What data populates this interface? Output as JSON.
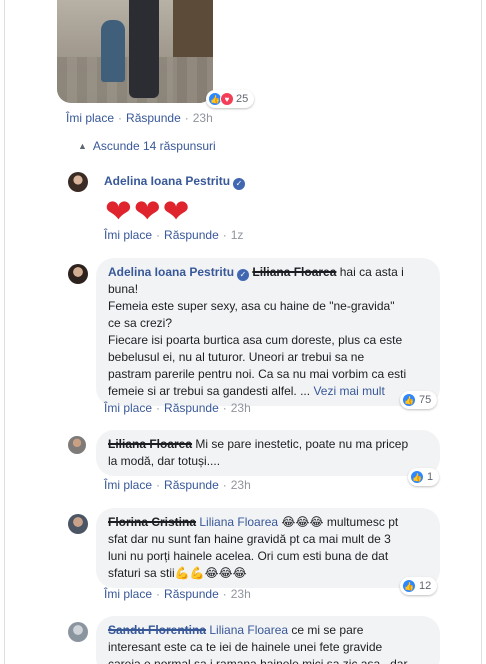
{
  "top_comment": {
    "reaction_count": "25",
    "actions": {
      "like": "Îmi place",
      "reply": "Răspunde",
      "time": "23h"
    }
  },
  "collapse_label": "Ascunde 14 răspunsuri",
  "comments": [
    {
      "author": "Adelina Ioana Pestritu",
      "hearts": [
        "❤",
        "❤",
        "❤"
      ],
      "actions": {
        "like": "Îmi place",
        "reply": "Răspunde",
        "time": "1z"
      }
    },
    {
      "author": "Adelina Ioana Pestritu",
      "mention": "Liliana Floarea",
      "text_line1": "hai ca asta i",
      "text_line2": "buna!",
      "text_line3": "Femeia este super sexy, asa cu haine de \"ne-gravida\"",
      "text_line4": "ce sa crezi?",
      "text_line5": "Fiecare isi poarta burtica asa cum doreste, plus ca este",
      "text_line6": "bebelusul ei, nu al tuturor. Uneori ar trebui sa ne",
      "text_line7": "pastram parerile pentru noi. Ca sa nu mai vorbim ca esti",
      "text_line8": "femeie si ar trebui sa gandesti alfel. ...",
      "see_more": "Vezi mai mult",
      "reaction_count": "75",
      "actions": {
        "like": "Îmi place",
        "reply": "Răspunde",
        "time": "23h"
      }
    },
    {
      "author": "Liliana Floarea",
      "text_line1": "Mi se pare inestetic, poate nu ma pricep",
      "text_line2": "la modă, dar totuși....",
      "reaction_count": "1",
      "actions": {
        "like": "Îmi place",
        "reply": "Răspunde",
        "time": "23h"
      }
    },
    {
      "author": "Florina Cristina",
      "mention": "Liliana Floarea",
      "emojis_a": "😂😂😂",
      "text_line1": "multumesc pt",
      "text_line2": "sfat dar nu sunt fan haine gravidă pt ca mai mult de 3",
      "text_line3": "luni nu porți hainele acelea. Ori cum esti buna de dat",
      "text_line4": "sfaturi sa stii",
      "emojis_b": "💪💪😂😂😂",
      "reaction_count": "12",
      "actions": {
        "like": "Îmi place",
        "reply": "Răspunde",
        "time": "23h"
      }
    },
    {
      "author": "Sandu Florentina",
      "mention": "Liliana Floarea",
      "text_line1": "ce mi se pare",
      "text_line2": "interesant este ca te iei de hainele unei fete gravide",
      "text_line3": "careia e normal sa i ramana hainele mici sa zic asa , dar"
    }
  ],
  "colors": {
    "link": "#385898",
    "bubble": "#f2f3f5",
    "meta": "#90949c",
    "heart": "#e0242e",
    "like": "#2d88ff",
    "love": "#f33e58"
  },
  "icons": [
    "like-icon",
    "love-icon",
    "verified-icon",
    "chevron-up-icon"
  ]
}
